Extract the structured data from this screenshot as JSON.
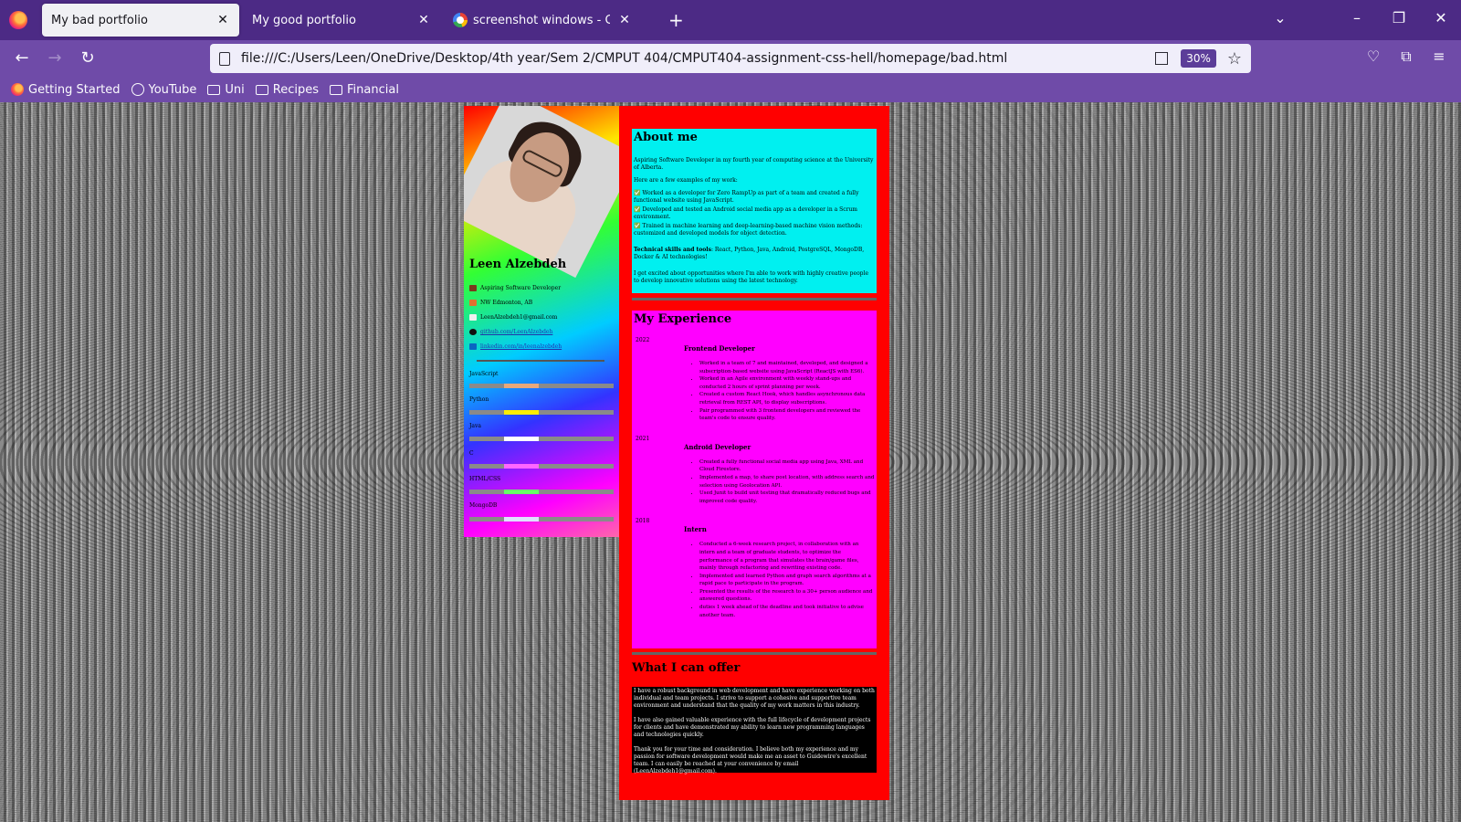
{
  "tabs": [
    {
      "title": "My bad portfolio",
      "active": true
    },
    {
      "title": "My good portfolio",
      "active": false
    },
    {
      "title": "screenshot windows - Google S",
      "active": false
    }
  ],
  "url": "file:///C:/Users/Leen/OneDrive/Desktop/4th year/Sem 2/CMPUT 404/CMPUT404-assignment-css-hell/homepage/bad.html",
  "zoom": "30%",
  "bookmarks": [
    "Getting Started",
    "YouTube",
    "Uni",
    "Recipes",
    "Financial"
  ],
  "profile": {
    "name": "Leen Alzebdeh",
    "title": "Aspiring Software Developer",
    "location": "NW Edmonton, AB",
    "email": "LeenAlzebdeh1@gmail.com",
    "github": "github.com/LeenAlzebdeh",
    "linkedin": "linkedin.com/in/leenalzebdeh"
  },
  "skills": [
    {
      "name": "JavaScript",
      "level": 0.4,
      "color": "#e8a87c"
    },
    {
      "name": "Python",
      "level": 0.4,
      "color": "#ffee00"
    },
    {
      "name": "Java",
      "level": 0.4,
      "color": "#ffffff"
    },
    {
      "name": "C",
      "level": 0.4,
      "color": "#ff66ff"
    },
    {
      "name": "HTML/CSS",
      "level": 0.4,
      "color": "#66ff66"
    },
    {
      "name": "MongoDB",
      "level": 0.4,
      "color": "#e0e0ff"
    }
  ],
  "about": {
    "heading": "About me",
    "intro": "Aspiring Software Developer in my fourth year of computing science at the University of Alberta.",
    "examples_lead": "Here are a few examples of my work:",
    "examples": [
      "✅ Worked as a developer for Zero RampUp as part of a team and created a fully functional website using JavaScript.",
      "✅ Developed and tested an Android social media app as a developer in a Scrum environment.",
      "✅ Trained in machine learning and deep-learning-based machine vision methods: customized and developed models for object detection."
    ],
    "skills_label": "Technical skills and tools",
    "skills_text": ": React, Python, Java, Android, PostgreSQL, MongoDB, Docker & AI technologies!",
    "closing": "I get excited about opportunities where I'm able to work with highly creative people to develop innovative solutions using the latest technology."
  },
  "experience": {
    "heading": "My Experience",
    "jobs": [
      {
        "year": "2022",
        "role": "Frontend Developer",
        "points": [
          "Worked in a team of 7 and maintained, developed, and designed a subscription-based website using JavaScript (ReactJS with ES6).",
          "Worked in an Agile environment with weekly stand-ups and conducted 2 hours of sprint planning per week.",
          "Created a custom React Hook, which handles asynchronous data retrieval from REST API, to display subscriptions.",
          "Pair programmed with 3 frontend developers and reviewed the team's code to ensure quality."
        ]
      },
      {
        "year": "2021",
        "role": "Android Developer",
        "points": [
          "Created a fully functional social media app using Java, XML and Cloud Firestore.",
          "Implemented a map, to share post location, with address search and selection using Geolocation API.",
          "Used Junit to build unit testing that dramatically reduced bugs and improved code quality."
        ]
      },
      {
        "year": "2018",
        "role": "Intern",
        "points": [
          "Conducted a 6-week research project, in collaboration with an intern and a team of graduate students, to optimize the performance of a program that simulates the brain/game files, mainly through refactoring and rewriting existing code.",
          "Implemented and learned Python and graph search algorithms at a rapid pace to participate in the program.",
          "Presented the results of the research to a 30+ person audience and answered questions.",
          "duties 1 week ahead of the deadline and took initiative to advise another team."
        ]
      }
    ]
  },
  "offer": {
    "heading": "What I can offer",
    "paragraphs": [
      "I have a robust background in web development and have experience working on both individual and team projects. I strive to support a cohesive and supportive team environment and understand that the quality of my work matters in this industry.",
      "I have also gained valuable experience with the full lifecycle of development projects for clients and have demonstrated my ability to learn new programming languages and technologies quickly.",
      "Thank you for your time and consideration. I believe both my experience and my passion for software development would make me an asset to Guidewire's excellent team. I can easily be reached at your convenience by email (LeenAlzebdeh1@gmail.com)."
    ]
  }
}
